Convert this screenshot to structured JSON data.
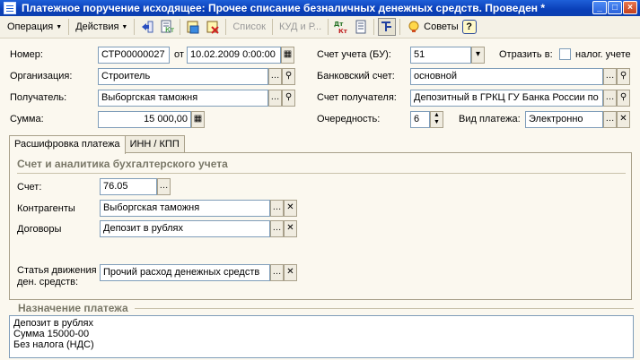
{
  "window": {
    "title": "Платежное поручение исходящее: Прочее списание безналичных денежных средств. Проведен *",
    "minimize": "_",
    "maximize": "□",
    "close": "×"
  },
  "toolbar": {
    "operation": "Операция",
    "actions": "Действия",
    "list": "Список",
    "kud": "КУД и Р...",
    "advice": "Советы",
    "help": "?"
  },
  "header": {
    "number_label": "Номер:",
    "number_value": "СТР00000027",
    "date_from_label": "от",
    "date_value": "10.02.2009  0:00:00",
    "org_label": "Организация:",
    "org_value": "Строитель",
    "recipient_label": "Получатель:",
    "recipient_value": "Выборгская таможня",
    "amount_label": "Сумма:",
    "amount_value": "15 000,00",
    "account_bu_label": "Счет учета (БУ):",
    "account_bu_value": "51",
    "reflect_label": "Отразить в:",
    "tax_label": "налог. учете",
    "bank_account_label": "Банковский счет:",
    "bank_account_value": "основной",
    "recipient_account_label": "Счет получателя:",
    "recipient_account_value": "Депозитный в ГРКЦ ГУ Банка России по",
    "priority_label": "Очередность:",
    "priority_value": "6",
    "payment_type_label": "Вид платежа:",
    "payment_type_value": "Электронно"
  },
  "tabs": [
    {
      "label": "Расшифровка платежа"
    },
    {
      "label": "ИНН / КПП"
    }
  ],
  "breakdown": {
    "group_title": "Счет и аналитика бухгалтерского учета",
    "account_label": "Счет:",
    "account_value": "76.05",
    "counterparties_label": "Контрагенты",
    "counterparties_value": "Выборгская таможня",
    "contracts_label": "Договоры",
    "contracts_value": "Депозит в рублях",
    "cashflow_label_1": "Статья движения",
    "cashflow_label_2": "ден. средств:",
    "cashflow_value": "Прочий расход денежных средств"
  },
  "purpose": {
    "title": "Назначение платежа",
    "line1": "Депозит в рублях",
    "line2": "Сумма 15000-00",
    "line3": "Без налога (НДС)"
  }
}
